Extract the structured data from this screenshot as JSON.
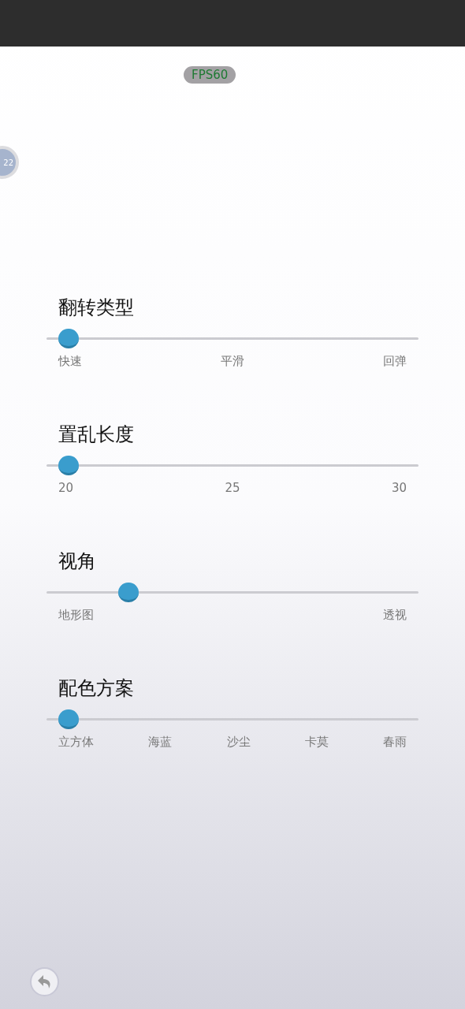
{
  "fps_badge": "FPS60",
  "side_badge": "22",
  "sliders": [
    {
      "title": "翻转类型",
      "level": 0.06,
      "ticks": [
        "快速",
        "平滑",
        "回弹"
      ]
    },
    {
      "title": "置乱长度",
      "level": 0.06,
      "ticks": [
        "20",
        "25",
        "30"
      ]
    },
    {
      "title": "视角",
      "level": 0.22,
      "ticks": [
        "地形图",
        "透视"
      ]
    },
    {
      "title": "配色方案",
      "level": 0.06,
      "ticks": [
        "立方体",
        "海蓝",
        "沙尘",
        "卡莫",
        "春雨"
      ]
    }
  ]
}
